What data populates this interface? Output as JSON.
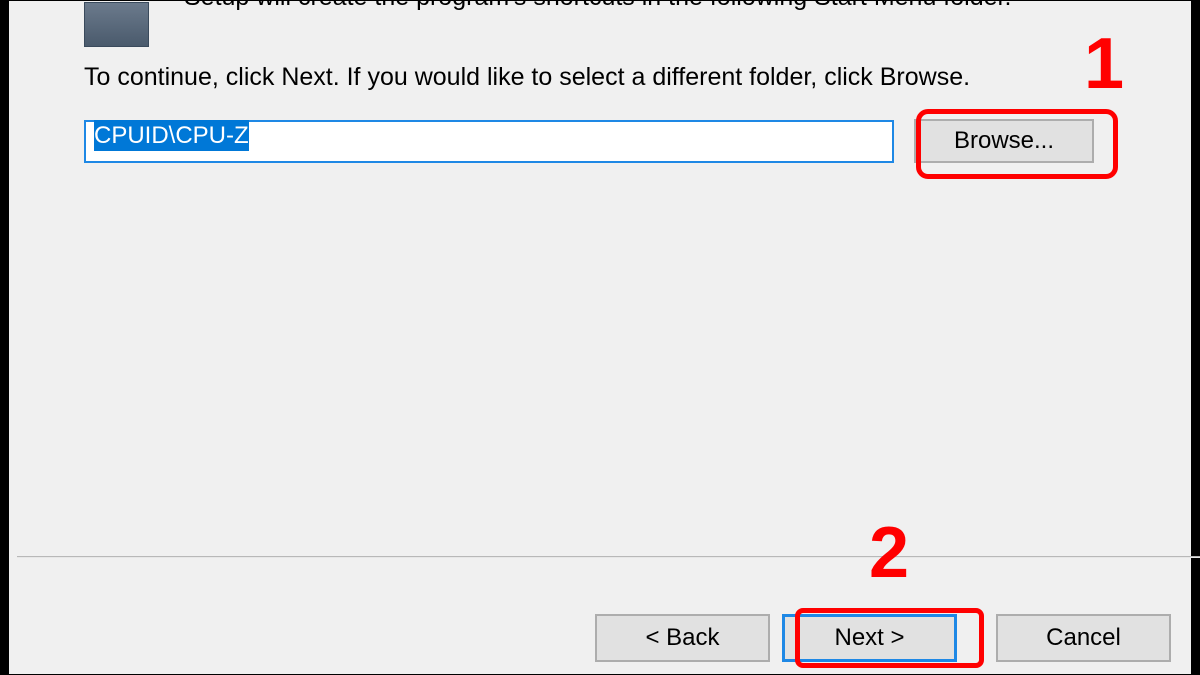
{
  "header_text": "Setup will create the program's shortcuts in the following Start Menu folder.",
  "instruction_text": "To continue, click Next. If you would like to select a different folder, click Browse.",
  "folder_path": "CPUID\\CPU-Z",
  "buttons": {
    "browse": "Browse...",
    "back": "< Back",
    "next": "Next >",
    "cancel": "Cancel"
  },
  "annotations": {
    "marker1": "1",
    "marker2": "2"
  }
}
